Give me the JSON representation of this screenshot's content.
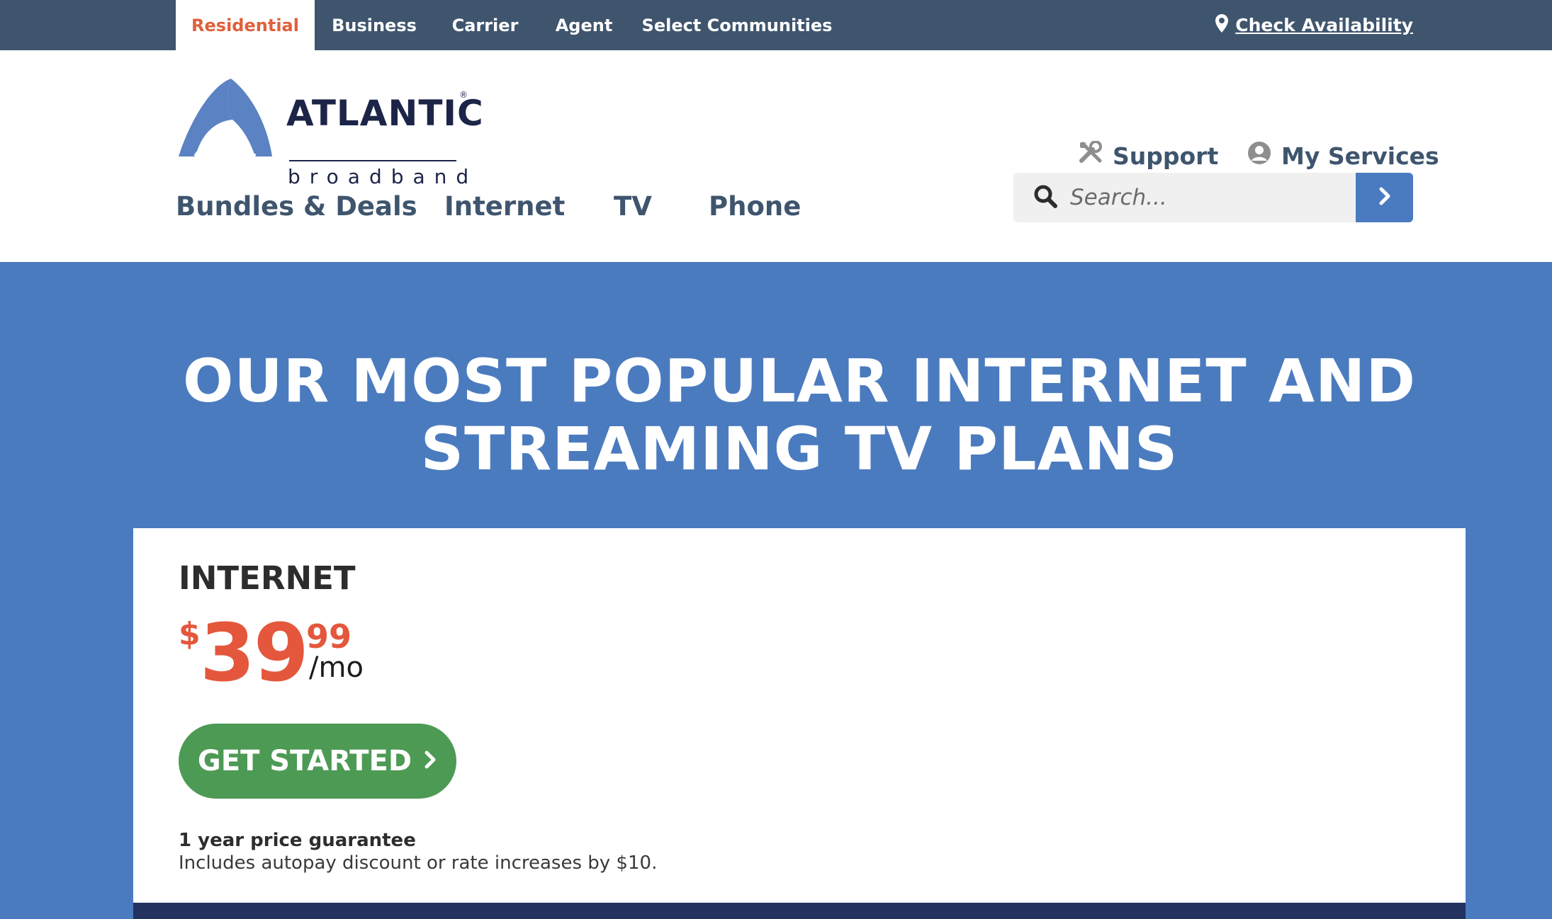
{
  "topbar": {
    "tabs": [
      {
        "label": "Residential",
        "active": true
      },
      {
        "label": "Business",
        "active": false
      },
      {
        "label": "Carrier",
        "active": false
      },
      {
        "label": "Agent",
        "active": false
      },
      {
        "label": "Select Communities",
        "active": false
      }
    ],
    "check_availability": "Check Availability"
  },
  "logo": {
    "brand": "ATLANTIC",
    "sub": "broadband",
    "reg": "®"
  },
  "utility_links": {
    "support": "Support",
    "my_services": "My Services"
  },
  "main_nav": {
    "items": [
      "Bundles & Deals",
      "Internet",
      "TV",
      "Phone"
    ]
  },
  "search": {
    "placeholder": "Search..."
  },
  "hero": {
    "title_line1": "OUR MOST POPULAR INTERNET AND",
    "title_line2": "STREAMING TV PLANS"
  },
  "card": {
    "title": "INTERNET",
    "price": {
      "currency": "$",
      "whole": "39",
      "cents": "99",
      "period": "/mo"
    },
    "cta_label": "GET STARTED",
    "guarantee": "1 year price guarantee",
    "disclaimer": "Includes autopay discount or rate increases by $10."
  },
  "colors": {
    "topbar": "#3f556e",
    "accent_orange": "#e0603b",
    "hero_blue": "#4b7bbf",
    "cta_green": "#4d9a55",
    "navy": "#1c2448"
  },
  "icons": {
    "location": "map-pin-icon",
    "support": "tools-icon",
    "account": "user-circle-icon",
    "search": "search-icon",
    "submit": "chevron-right-icon"
  }
}
